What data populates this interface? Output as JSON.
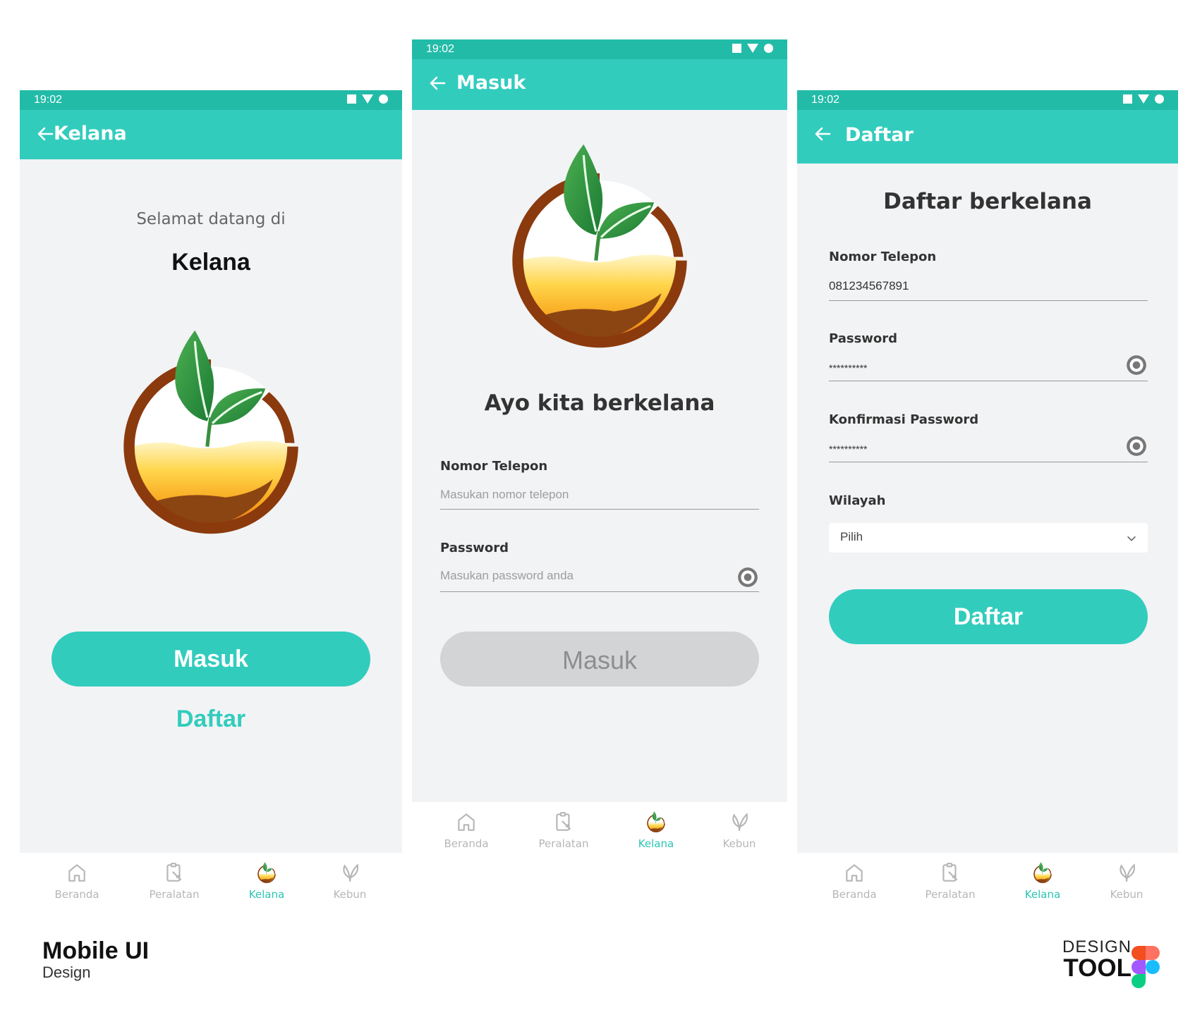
{
  "status": {
    "time": "19:02"
  },
  "screen1": {
    "appbar_title": "Kelana",
    "welcome": "Selamat datang di",
    "app_name": "Kelana",
    "login_button": "Masuk",
    "register_link": "Daftar"
  },
  "screen2": {
    "appbar_title": "Masuk",
    "heading": "Ayo kita berkelana",
    "phone_label": "Nomor Telepon",
    "phone_placeholder": "Masukan nomor telepon",
    "password_label": "Password",
    "password_placeholder": "Masukan password anda",
    "login_button": "Masuk"
  },
  "screen3": {
    "appbar_title": "Daftar",
    "heading": "Daftar berkelana",
    "phone_label": "Nomor Telepon",
    "phone_value": "081234567891",
    "password_label": "Password",
    "password_value": "**********",
    "confirm_label": "Konfirmasi Password",
    "confirm_value": "**********",
    "region_label": "Wilayah",
    "region_value": "Pilih",
    "register_button": "Daftar"
  },
  "nav": {
    "home": "Beranda",
    "tools": "Peralatan",
    "kelana": "Kelana",
    "garden": "Kebun"
  },
  "footer": {
    "title": "Mobile UI",
    "subtitle": "Design",
    "tool_line1": "DESIGN",
    "tool_line2": "TOOL"
  },
  "colors": {
    "primary": "#32ccbd",
    "status_bar": "#22bba8",
    "background": "#f2f3f5",
    "disabled_button": "#d3d4d6"
  },
  "icons": [
    "back-arrow-icon",
    "home-icon",
    "clipboard-tools-icon",
    "kelana-logo-icon",
    "leaf-icon",
    "eye-icon",
    "chevron-down-icon",
    "figma-logo"
  ]
}
